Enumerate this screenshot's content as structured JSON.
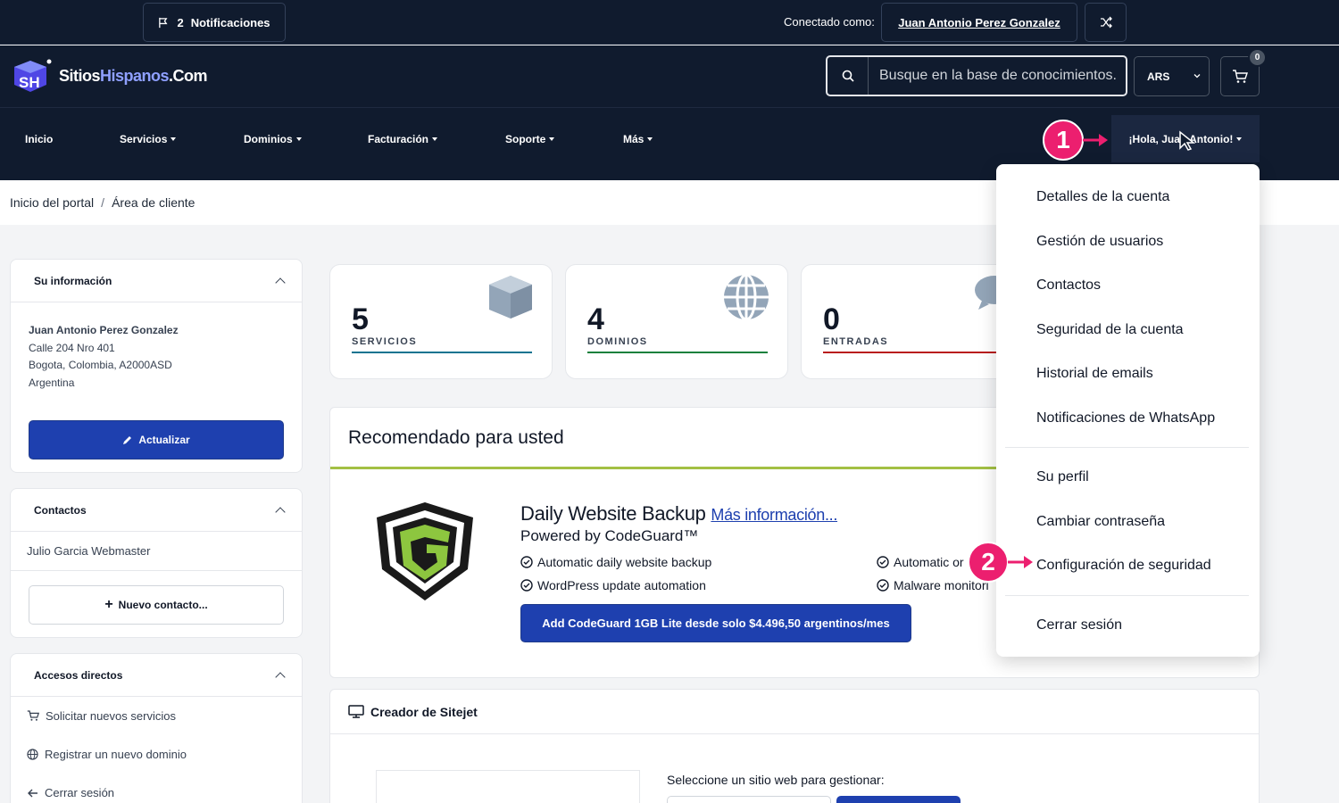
{
  "topbar": {
    "notif_count": "2",
    "notif_label": "Notificaciones",
    "logged_label": "Conectado como:",
    "user_name": "Juan Antonio Perez Gonzalez"
  },
  "header": {
    "logo_part1": "Sitios",
    "logo_part2": "Hispanos",
    "logo_part3": ".Com",
    "search_placeholder": "Busque en la base de conocimientos.",
    "currency": "ARS",
    "cart_count": "0"
  },
  "nav": {
    "items": [
      {
        "label": "Inicio"
      },
      {
        "label": "Servicios"
      },
      {
        "label": "Dominios"
      },
      {
        "label": "Facturación"
      },
      {
        "label": "Soporte"
      },
      {
        "label": "Más"
      }
    ],
    "greeting": "¡Hola, Juan Antonio!"
  },
  "breadcrumb": {
    "home": "Inicio del portal",
    "separator": "/",
    "current": "Área de cliente"
  },
  "sidebar": {
    "info": {
      "title": "Su información",
      "name": "Juan Antonio Perez Gonzalez",
      "address": "Calle 204 Nro 401",
      "city": "Bogota, Colombia, A2000ASD",
      "country": "Argentina",
      "update_button": "Actualizar"
    },
    "contacts": {
      "title": "Contactos",
      "contact": "Julio Garcia Webmaster",
      "new_button": "Nuevo contacto..."
    },
    "shortcuts": {
      "title": "Accesos directos",
      "items": [
        {
          "label": "Solicitar nuevos servicios"
        },
        {
          "label": "Registrar un nuevo dominio"
        },
        {
          "label": "Cerrar sesión"
        }
      ]
    }
  },
  "stats": [
    {
      "value": "5",
      "label": "SERVICIOS",
      "color": "#0e7490"
    },
    {
      "value": "4",
      "label": "DOMINIOS",
      "color": "#15803d"
    },
    {
      "value": "0",
      "label": "ENTRADAS",
      "color": "#b91c1c"
    }
  ],
  "recommended": {
    "title": "Recomendado para usted",
    "product": "Daily Website Backup",
    "more_link": "Más información...",
    "powered": "Powered by CodeGuard™",
    "features": [
      {
        "label": "Automatic daily website backup"
      },
      {
        "label": "WordPress update automation"
      },
      {
        "label": "Automatic or"
      },
      {
        "label": "Malware monitori"
      }
    ],
    "cta": "Add CodeGuard 1GB Lite desde solo $4.496,50 argentinos/mes"
  },
  "sitejet": {
    "title": "Creador de Sitejet",
    "select_label": "Seleccione un sitio web para gestionar:"
  },
  "dropdown": {
    "items": [
      {
        "label": "Detalles de la cuenta"
      },
      {
        "label": "Gestión de usuarios"
      },
      {
        "label": "Contactos"
      },
      {
        "label": "Seguridad de la cuenta"
      },
      {
        "label": "Historial de emails"
      },
      {
        "label": "Notificaciones de WhatsApp"
      },
      {
        "label": "Su perfil"
      },
      {
        "label": "Cambiar contraseña"
      },
      {
        "label": "Configuración de seguridad"
      },
      {
        "label": "Cerrar sesión"
      }
    ]
  },
  "annotations": {
    "step1": "1",
    "step2": "2",
    "color": "#ec1f6f"
  },
  "colors": {
    "navy": "#101b2e",
    "primary": "#1e40af",
    "accent_green": "#a3c044"
  }
}
